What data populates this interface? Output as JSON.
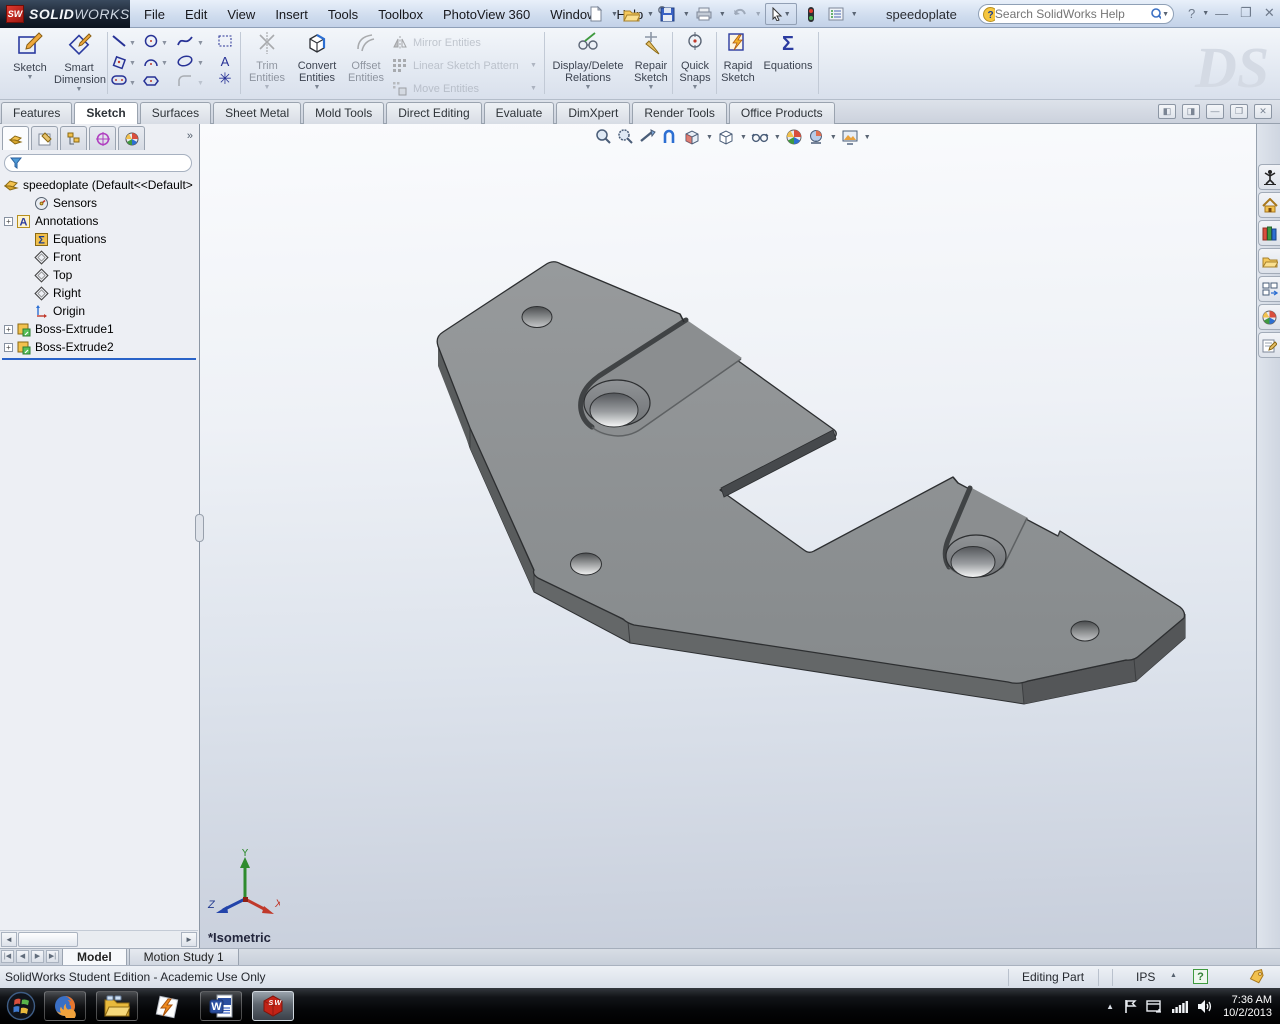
{
  "titlebar": {
    "brand_bold": "SOLID",
    "brand_light": "WORKS",
    "logo_text": "SW",
    "menus": [
      "File",
      "Edit",
      "View",
      "Insert",
      "Tools",
      "Toolbox",
      "PhotoView 360",
      "Window",
      "Help"
    ],
    "document_name": "speedoplate",
    "search_placeholder": "Search SolidWorks Help"
  },
  "ribbon": {
    "tabs": [
      "Features",
      "Sketch",
      "Surfaces",
      "Sheet Metal",
      "Mold Tools",
      "Direct Editing",
      "Evaluate",
      "DimXpert",
      "Render Tools",
      "Office Products"
    ],
    "active_tab": "Sketch",
    "buttons": {
      "sketch": "Sketch",
      "smart_dimension": "Smart Dimension",
      "trim_entities": "Trim Entities",
      "convert_entities": "Convert Entities",
      "offset_entities": "Offset Entities",
      "mirror_entities": "Mirror Entities",
      "linear_sketch_pattern": "Linear Sketch Pattern",
      "move_entities": "Move Entities",
      "display_delete_relations": "Display/Delete Relations",
      "repair_sketch": "Repair Sketch",
      "quick_snaps": "Quick Snaps",
      "rapid_sketch": "Rapid Sketch",
      "equations": "Equations"
    },
    "watermark": "DS"
  },
  "feature_tree": {
    "items": [
      {
        "label": "speedoplate  (Default<<Default>"
      },
      {
        "label": "Sensors"
      },
      {
        "label": "Annotations"
      },
      {
        "label": "Equations"
      },
      {
        "label": "Front"
      },
      {
        "label": "Top"
      },
      {
        "label": "Right"
      },
      {
        "label": "Origin"
      },
      {
        "label": "Boss-Extrude1"
      },
      {
        "label": "Boss-Extrude2"
      }
    ]
  },
  "viewport": {
    "view_label": "*Isometric",
    "axis_x": "X",
    "axis_y": "Y",
    "axis_z": "Z"
  },
  "doc_tabs": {
    "model": "Model",
    "motion_study": "Motion Study 1"
  },
  "statusbar": {
    "message": "SolidWorks Student Edition - Academic Use Only",
    "mode": "Editing Part",
    "units": "IPS"
  },
  "taskbar": {
    "time": "7:36 AM",
    "date": "10/2/2013"
  },
  "colors": {
    "accent_blue": "#2a63c8",
    "part_gray": "#8e9193",
    "logo_red": "#c32317"
  }
}
